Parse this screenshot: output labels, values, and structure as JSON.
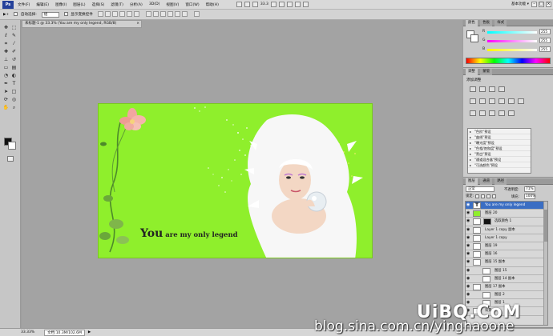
{
  "menubar": {
    "logo": "Ps",
    "items": [
      "文件(F)",
      "编辑(E)",
      "图像(I)",
      "图层(L)",
      "选择(S)",
      "滤镜(T)",
      "分析(A)",
      "3D(D)",
      "视图(V)",
      "窗口(W)",
      "帮助(H)"
    ],
    "zoom": "33.3",
    "workspace": "基本功能 ▾",
    "window_buttons": [
      "–",
      "□",
      "×"
    ]
  },
  "optbar": {
    "tool_glyph": "▶+",
    "auto_select_label": "自动选择:",
    "auto_select_value": "组",
    "show_transform_label": "显示变换控件"
  },
  "document": {
    "tab_title": "未标题-1 @ 33.3% (You are my only legend, RGB/8)",
    "tab_close": "×",
    "caption_big": "You",
    "caption_small": " are my only legend",
    "colors": {
      "canvas_bg": "#8fef2c",
      "flower_petal": "#f2a6a0",
      "vine": "#4d8a2a"
    }
  },
  "statusbar": {
    "zoom": "33.33%",
    "doc_size": "文档:10.3M/102.6M",
    "arrow": "▶"
  },
  "color_panel": {
    "tabs": [
      "颜色",
      "色板",
      "样式"
    ],
    "rows": [
      {
        "label": "R",
        "value": "255",
        "gradient": "linear-gradient(to right,#00ffff,#ffffff)"
      },
      {
        "label": "G",
        "value": "255",
        "gradient": "linear-gradient(to right,#ff00ff,#ffffff)"
      },
      {
        "label": "B",
        "value": "255",
        "gradient": "linear-gradient(to right,#ffff00,#ffffff)"
      }
    ]
  },
  "adjustments_panel": {
    "tabs": [
      "调整",
      "蒙版"
    ],
    "title": "添加调整",
    "presets": [
      "\"色阶\"预设",
      "\"曲线\"预设",
      "\"曝光度\"预设",
      "\"色相/饱和度\"预设",
      "\"黑白\"预设",
      "\"通道混合器\"预设",
      "\"可选颜色\"预设"
    ]
  },
  "layers_panel": {
    "tabs": [
      "图层",
      "通道",
      "路径"
    ],
    "blend_mode": "正常",
    "opacity_label": "不透明度:",
    "opacity_value": "71%",
    "lock_label": "锁定:",
    "fill_label": "填充:",
    "fill_value": "100%",
    "layers": [
      {
        "name": "You are my only legend",
        "thumb": "text",
        "thumb_text": "T",
        "selected": true
      },
      {
        "name": "图层 20",
        "thumb": "green"
      },
      {
        "name": "选取颜色 1",
        "thumb": "plain",
        "masked": true
      },
      {
        "name": "Layer 1 copy 副本",
        "thumb": "plain"
      },
      {
        "name": "Layer 1 copy",
        "thumb": "plain"
      },
      {
        "name": "图层 19",
        "thumb": "plain"
      },
      {
        "name": "图层 16",
        "thumb": "plain"
      },
      {
        "name": "图层 15 副本",
        "thumb": "plain"
      },
      {
        "name": "图层 15",
        "thumb": "plain",
        "indent": true
      },
      {
        "name": "图层 14 副本",
        "thumb": "plain",
        "indent": true
      },
      {
        "name": "图层 17 副本",
        "thumb": "plain"
      },
      {
        "name": "图层 2",
        "thumb": "plain",
        "indent": true
      },
      {
        "name": "图层 1",
        "thumb": "plain",
        "indent": true
      },
      {
        "name": "背景",
        "thumb": "plain"
      }
    ]
  },
  "watermark": {
    "logo": "UiBQ.CoM",
    "blog": "blog.sina.com.cn/yinghaoone"
  }
}
